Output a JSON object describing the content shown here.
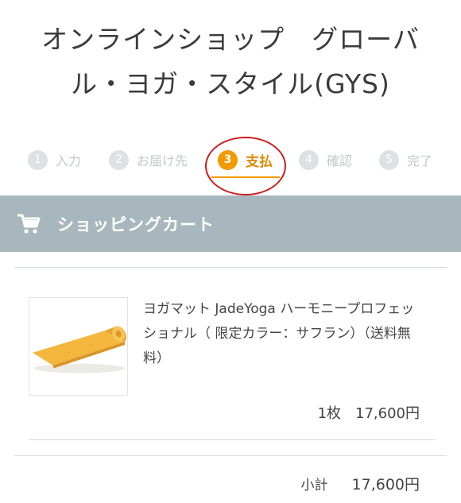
{
  "shop": {
    "title_line1": "オンラインショップ　グローバ",
    "title_line2": "ル・ヨガ・スタイル(GYS)"
  },
  "steps": [
    {
      "num": "1",
      "label": "入力",
      "active": false
    },
    {
      "num": "2",
      "label": "お届け先",
      "active": false
    },
    {
      "num": "3",
      "label": "支払",
      "active": true
    },
    {
      "num": "4",
      "label": "確認",
      "active": false
    },
    {
      "num": "5",
      "label": "完了",
      "active": false
    }
  ],
  "colors": {
    "accent": "#f39a00",
    "inactive_step": "#c4c8cb",
    "cart_bar": "#a8b7bd",
    "annotation": "#cc1e1e"
  },
  "cart": {
    "icon": "cart-icon",
    "title": "ショッピングカート"
  },
  "product": {
    "name": "ヨガマット JadeYoga ハーモニープロフェッショナル（ 限定カラー：サフラン）（送料無料）",
    "quantity": "1枚",
    "price": "17,600円"
  },
  "subtotal": {
    "label": "小計",
    "amount": "17,600円"
  }
}
